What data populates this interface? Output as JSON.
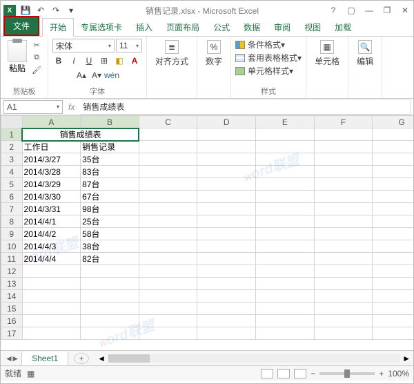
{
  "window": {
    "doc_title": "销售记录.xlsx - Microsoft Excel",
    "help": "?",
    "ribbon_toggle": "▢",
    "minimize": "—",
    "doc_max": "❐",
    "close": "✕"
  },
  "qat": {
    "save_icon": "💾",
    "undo_icon": "↶",
    "redo_icon": "↷",
    "more_icon": "▾"
  },
  "tabs": {
    "file": "文件",
    "home": "开始",
    "addins": "专属选项卡",
    "insert": "插入",
    "pagelayout": "页面布局",
    "formulas": "公式",
    "data": "数据",
    "review": "审阅",
    "view": "视图",
    "loadtest": "加载"
  },
  "ribbon": {
    "clipboard": {
      "paste": "粘贴",
      "label": "剪贴板",
      "cut_icon": "✂",
      "copy_icon": "⧉",
      "painter_icon": "🖌"
    },
    "font": {
      "name": "宋体",
      "size": "11",
      "bold": "B",
      "italic": "I",
      "underline": "U",
      "border_icon": "⊞",
      "fill_icon": "◧",
      "fontcolor_icon": "A",
      "grow_icon": "A▴",
      "shrink_icon": "A▾",
      "phonetic": "wén",
      "label": "字体"
    },
    "align": {
      "label_btn": "对齐方式",
      "icon": "≣"
    },
    "number": {
      "label_btn": "数字",
      "icon": "%"
    },
    "styles": {
      "cond": "条件格式▾",
      "tbl": "套用表格格式▾",
      "cell": "单元格样式▾",
      "label": "样式"
    },
    "cells": {
      "label_btn": "单元格",
      "icon": "▦"
    },
    "editing": {
      "label_btn": "编辑",
      "icon": "🔍"
    }
  },
  "namebox": "A1",
  "namebox_arrow": "▾",
  "fx_label": "fx",
  "formula": "销售成绩表",
  "columns": [
    "A",
    "B",
    "C",
    "D",
    "E",
    "F",
    "G"
  ],
  "rows_count": 17,
  "merged_header": "销售成绩表",
  "table_header": {
    "a": "工作日",
    "b": "销售记录"
  },
  "data": [
    {
      "date": "2014/3/27",
      "val": "35台"
    },
    {
      "date": "2014/3/28",
      "val": "83台"
    },
    {
      "date": "2014/3/29",
      "val": "87台"
    },
    {
      "date": "2014/3/30",
      "val": "67台"
    },
    {
      "date": "2014/3/31",
      "val": "98台"
    },
    {
      "date": "2014/4/1",
      "val": "25台"
    },
    {
      "date": "2014/4/2",
      "val": "58台"
    },
    {
      "date": "2014/4/3",
      "val": "38台"
    },
    {
      "date": "2014/4/4",
      "val": "82台"
    }
  ],
  "sheet_tab": "Sheet1",
  "add_sheet": "+",
  "scroll_arrows": {
    "l": "◄",
    "r": "►"
  },
  "status": {
    "ready": "就绪",
    "mode_icon": "▦"
  },
  "zoom": {
    "minus": "−",
    "plus": "+",
    "value": "100%"
  },
  "watermark": "Word联盟"
}
